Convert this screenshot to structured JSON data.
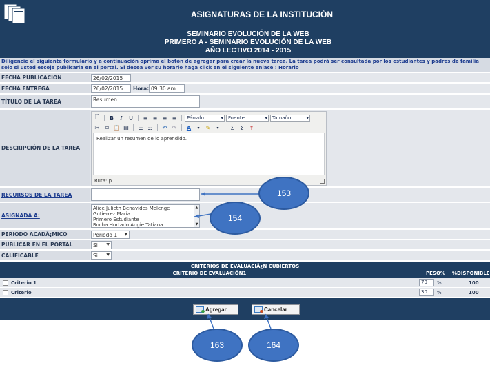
{
  "header": {
    "title": "ASIGNATURAS DE LA INSTITUCIÓN",
    "subtitle_1": "SEMINARIO EVOLUCIÓN DE LA WEB",
    "subtitle_2": "PRIMERO A - SEMINARIO EVOLUCIÓN DE LA WEB",
    "subtitle_3": "AÑO LECTIVO 2014 - 2015",
    "logo_icon": "folder-stack-icon"
  },
  "instructions": {
    "text": "Diligencie el siguiente formulario y a continuación oprima el botón de agregar para crear la nueva tarea. La tarea podrá ser consultada por los estudiantes y padres de familia solo si usted escoje publicarla en el portal. Si desea ver su horario haga click en el siguiente enlace :",
    "link": "Horario"
  },
  "form": {
    "fecha_publicacion_label": "FECHA PUBLICACION",
    "fecha_publicacion_value": "26/02/2015",
    "fecha_entrega_label": "FECHA ENTREGA",
    "fecha_entrega_value": "26/02/2015",
    "hora_label": "Hora:",
    "hora_value": "09:30 am",
    "titulo_label": "TÍTULO DE LA TAREA",
    "titulo_value": "Resumen",
    "descripcion_label": "DESCRIPCIÓN DE LA TAREA",
    "editor": {
      "format_value": "Párrafo",
      "font_value": "Fuente",
      "size_value": "Tamaño",
      "content": "Realizar un resumen de lo aprendido.",
      "path": "Ruta: p"
    },
    "recursos_label": "RECURSOS DE LA TAREA",
    "asignada_label": "ASIGNADA A:",
    "asignada_items": [
      "Alice Julieth Benavides Melenge",
      "Gutierrez Maria",
      "Primero Estudiante",
      "Rocha Hurtado Angie Tatiana"
    ],
    "periodo_label": "PERIODO ACADÃ¡MICO",
    "periodo_value": "Periodo 1",
    "publicar_label": "PUBLICAR EN EL PORTAL",
    "publicar_value": "Si",
    "calificable_label": "CALIFICABLE",
    "calificable_value": "Si"
  },
  "criteria": {
    "header": "CRITERIOS DE EVALUACIÃ¿N CUBIERTOS",
    "col_name": "CRITERIO DE EVALUACIÓN1",
    "col_peso": "PESO%",
    "col_disp": "%DISPONIBLE",
    "rows": [
      {
        "name": "Criterio 1",
        "peso": "70",
        "pct": "%",
        "disp": "100"
      },
      {
        "name": "Criterio",
        "peso": "30",
        "pct": "%",
        "disp": "100"
      }
    ]
  },
  "buttons": {
    "add_label": "Agregar",
    "cancel_label": "Cancelar"
  },
  "annotations": {
    "a153": "153",
    "a154": "154",
    "a163": "163",
    "a164": "164"
  },
  "colors": {
    "header_bg": "#1f3f62",
    "label_bg": "#d9dde4",
    "bubble": "#3f73c2"
  }
}
